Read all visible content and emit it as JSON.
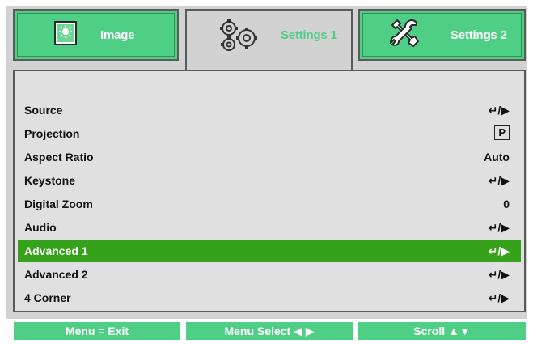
{
  "tabs": [
    {
      "label": "Image",
      "icon": "image-icon"
    },
    {
      "label": "Settings 1",
      "icon": "gears-icon",
      "active": true
    },
    {
      "label": "Settings 2",
      "icon": "tools-icon"
    }
  ],
  "menu": [
    {
      "label": "Source",
      "value": "↵/▶"
    },
    {
      "label": "Projection",
      "value": "P"
    },
    {
      "label": "Aspect Ratio",
      "value": "Auto"
    },
    {
      "label": "Keystone",
      "value": "↵/▶"
    },
    {
      "label": "Digital Zoom",
      "value": "0"
    },
    {
      "label": "Audio",
      "value": "↵/▶"
    },
    {
      "label": "Advanced 1",
      "value": "↵/▶",
      "selected": true
    },
    {
      "label": "Advanced 2",
      "value": "↵/▶"
    },
    {
      "label": "4 Corner",
      "value": "↵/▶"
    }
  ],
  "footer": {
    "exit": "Menu = Exit",
    "select": "Menu Select ◀ ▶",
    "scroll": "Scroll ▲▼"
  },
  "colors": {
    "tab_green": "#4fcf86",
    "selected_green": "#36a21c",
    "frame_gray": "#d2d2d2",
    "panel_gray": "#e0e0e0"
  }
}
